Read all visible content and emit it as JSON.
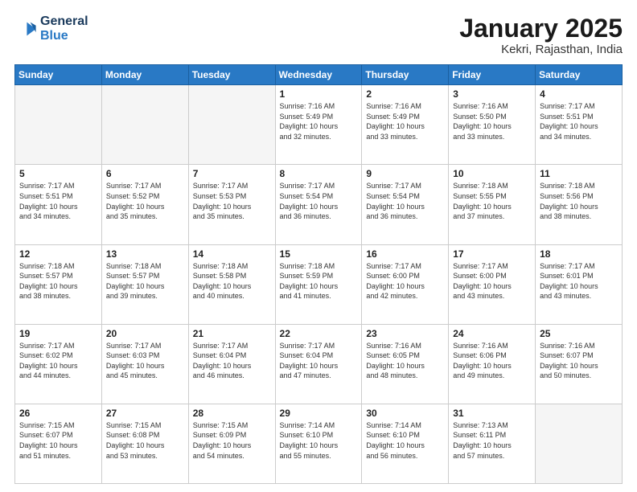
{
  "header": {
    "logo_line1": "General",
    "logo_line2": "Blue",
    "month": "January 2025",
    "location": "Kekri, Rajasthan, India"
  },
  "days_of_week": [
    "Sunday",
    "Monday",
    "Tuesday",
    "Wednesday",
    "Thursday",
    "Friday",
    "Saturday"
  ],
  "weeks": [
    [
      {
        "day": "",
        "empty": true
      },
      {
        "day": "",
        "empty": true
      },
      {
        "day": "",
        "empty": true
      },
      {
        "day": "1",
        "sunrise": "7:16 AM",
        "sunset": "5:49 PM",
        "daylight": "10 hours and 32 minutes."
      },
      {
        "day": "2",
        "sunrise": "7:16 AM",
        "sunset": "5:49 PM",
        "daylight": "10 hours and 33 minutes."
      },
      {
        "day": "3",
        "sunrise": "7:16 AM",
        "sunset": "5:50 PM",
        "daylight": "10 hours and 33 minutes."
      },
      {
        "day": "4",
        "sunrise": "7:17 AM",
        "sunset": "5:51 PM",
        "daylight": "10 hours and 34 minutes."
      }
    ],
    [
      {
        "day": "5",
        "sunrise": "7:17 AM",
        "sunset": "5:51 PM",
        "daylight": "10 hours and 34 minutes."
      },
      {
        "day": "6",
        "sunrise": "7:17 AM",
        "sunset": "5:52 PM",
        "daylight": "10 hours and 35 minutes."
      },
      {
        "day": "7",
        "sunrise": "7:17 AM",
        "sunset": "5:53 PM",
        "daylight": "10 hours and 35 minutes."
      },
      {
        "day": "8",
        "sunrise": "7:17 AM",
        "sunset": "5:54 PM",
        "daylight": "10 hours and 36 minutes."
      },
      {
        "day": "9",
        "sunrise": "7:17 AM",
        "sunset": "5:54 PM",
        "daylight": "10 hours and 36 minutes."
      },
      {
        "day": "10",
        "sunrise": "7:18 AM",
        "sunset": "5:55 PM",
        "daylight": "10 hours and 37 minutes."
      },
      {
        "day": "11",
        "sunrise": "7:18 AM",
        "sunset": "5:56 PM",
        "daylight": "10 hours and 38 minutes."
      }
    ],
    [
      {
        "day": "12",
        "sunrise": "7:18 AM",
        "sunset": "5:57 PM",
        "daylight": "10 hours and 38 minutes."
      },
      {
        "day": "13",
        "sunrise": "7:18 AM",
        "sunset": "5:57 PM",
        "daylight": "10 hours and 39 minutes."
      },
      {
        "day": "14",
        "sunrise": "7:18 AM",
        "sunset": "5:58 PM",
        "daylight": "10 hours and 40 minutes."
      },
      {
        "day": "15",
        "sunrise": "7:18 AM",
        "sunset": "5:59 PM",
        "daylight": "10 hours and 41 minutes."
      },
      {
        "day": "16",
        "sunrise": "7:17 AM",
        "sunset": "6:00 PM",
        "daylight": "10 hours and 42 minutes."
      },
      {
        "day": "17",
        "sunrise": "7:17 AM",
        "sunset": "6:00 PM",
        "daylight": "10 hours and 43 minutes."
      },
      {
        "day": "18",
        "sunrise": "7:17 AM",
        "sunset": "6:01 PM",
        "daylight": "10 hours and 43 minutes."
      }
    ],
    [
      {
        "day": "19",
        "sunrise": "7:17 AM",
        "sunset": "6:02 PM",
        "daylight": "10 hours and 44 minutes."
      },
      {
        "day": "20",
        "sunrise": "7:17 AM",
        "sunset": "6:03 PM",
        "daylight": "10 hours and 45 minutes."
      },
      {
        "day": "21",
        "sunrise": "7:17 AM",
        "sunset": "6:04 PM",
        "daylight": "10 hours and 46 minutes."
      },
      {
        "day": "22",
        "sunrise": "7:17 AM",
        "sunset": "6:04 PM",
        "daylight": "10 hours and 47 minutes."
      },
      {
        "day": "23",
        "sunrise": "7:16 AM",
        "sunset": "6:05 PM",
        "daylight": "10 hours and 48 minutes."
      },
      {
        "day": "24",
        "sunrise": "7:16 AM",
        "sunset": "6:06 PM",
        "daylight": "10 hours and 49 minutes."
      },
      {
        "day": "25",
        "sunrise": "7:16 AM",
        "sunset": "6:07 PM",
        "daylight": "10 hours and 50 minutes."
      }
    ],
    [
      {
        "day": "26",
        "sunrise": "7:15 AM",
        "sunset": "6:07 PM",
        "daylight": "10 hours and 51 minutes."
      },
      {
        "day": "27",
        "sunrise": "7:15 AM",
        "sunset": "6:08 PM",
        "daylight": "10 hours and 53 minutes."
      },
      {
        "day": "28",
        "sunrise": "7:15 AM",
        "sunset": "6:09 PM",
        "daylight": "10 hours and 54 minutes."
      },
      {
        "day": "29",
        "sunrise": "7:14 AM",
        "sunset": "6:10 PM",
        "daylight": "10 hours and 55 minutes."
      },
      {
        "day": "30",
        "sunrise": "7:14 AM",
        "sunset": "6:10 PM",
        "daylight": "10 hours and 56 minutes."
      },
      {
        "day": "31",
        "sunrise": "7:13 AM",
        "sunset": "6:11 PM",
        "daylight": "10 hours and 57 minutes."
      },
      {
        "day": "",
        "empty": true
      }
    ]
  ],
  "labels": {
    "sunrise": "Sunrise:",
    "sunset": "Sunset:",
    "daylight": "Daylight:"
  }
}
